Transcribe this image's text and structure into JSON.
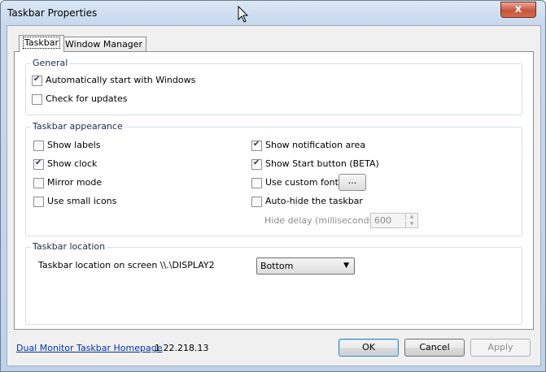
{
  "window": {
    "title": "Taskbar Properties",
    "close_glyph": "x"
  },
  "tabs": [
    {
      "label": "Taskbar"
    },
    {
      "label": "Window Manager"
    }
  ],
  "general": {
    "legend": "General",
    "auto_start": {
      "label": "Automatically start with Windows",
      "checked": true
    },
    "check_updates": {
      "label": "Check for updates",
      "checked": false
    }
  },
  "appearance": {
    "legend": "Taskbar appearance",
    "show_labels": {
      "label": "Show labels",
      "checked": false
    },
    "show_clock": {
      "label": "Show clock",
      "checked": true
    },
    "mirror_mode": {
      "label": "Mirror mode",
      "checked": false
    },
    "small_icons": {
      "label": "Use small icons",
      "checked": false
    },
    "notification_area": {
      "label": "Show notification area",
      "checked": true
    },
    "start_button": {
      "label": "Show Start button (BETA)",
      "checked": true
    },
    "custom_font": {
      "label": "Use custom font:",
      "checked": false,
      "button": "..."
    },
    "auto_hide": {
      "label": "Auto-hide the taskbar",
      "checked": false
    },
    "hide_delay": {
      "label": "Hide delay (milliseconds):",
      "value": "600"
    }
  },
  "location": {
    "legend": "Taskbar location",
    "label": "Taskbar location on screen \\\\.\\DISPLAY2",
    "selected": "Bottom"
  },
  "footer": {
    "homepage_link": "Dual Monitor Taskbar Homepage",
    "version": "1.22.218.13",
    "ok": "OK",
    "cancel": "Cancel",
    "apply": "Apply"
  },
  "colors": {
    "link": "#0033aa",
    "close_button": "#c8553c"
  }
}
